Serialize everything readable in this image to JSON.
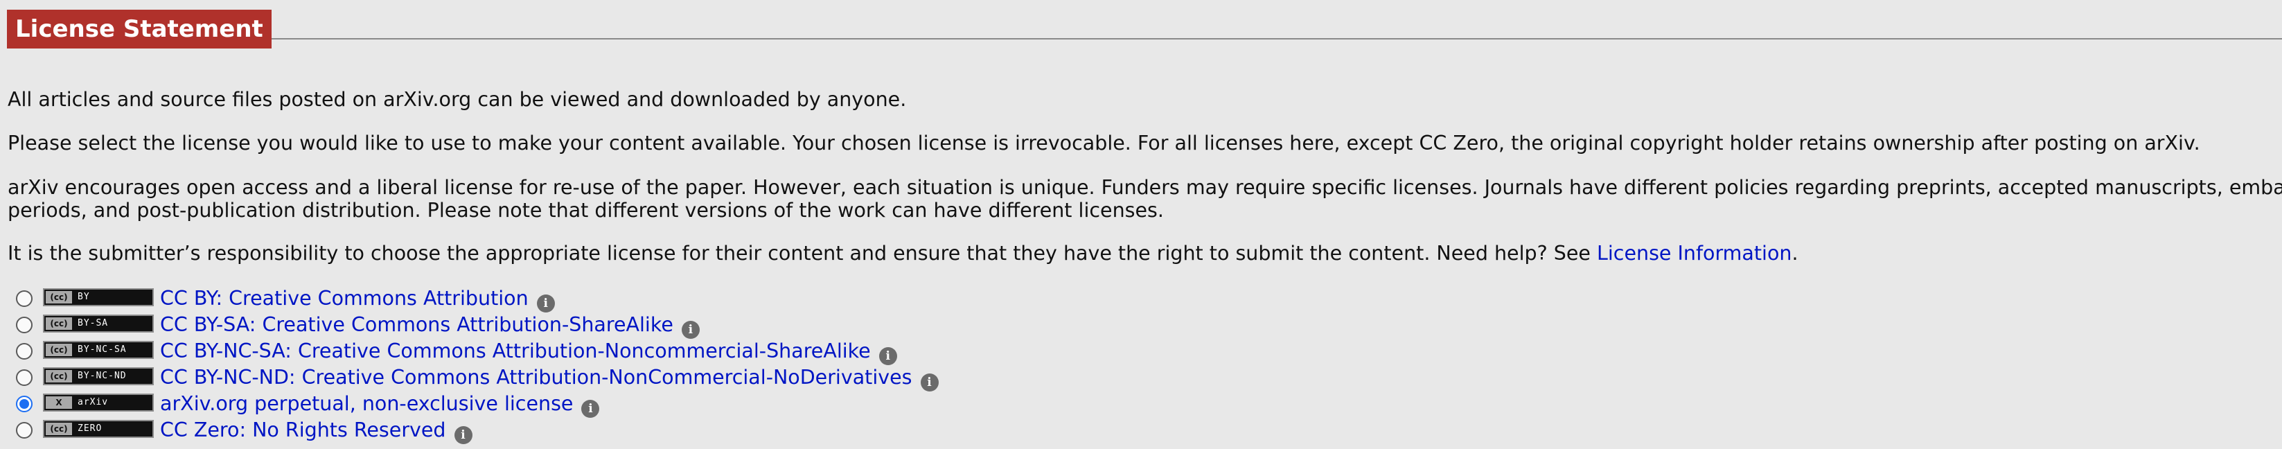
{
  "section": {
    "title": "License Statement"
  },
  "paragraphs": {
    "p1": "All articles and source files posted on arXiv.org can be viewed and downloaded by anyone.",
    "p2": "Please select the license you would like to use to make your content available. Your chosen license is irrevocable. For all licenses here, except CC Zero, the original copyright holder retains ownership after posting on arXiv.",
    "p3_line1": "arXiv encourages open access and a liberal license for re-use of the paper. However, each situation is unique. Funders may require specific licenses. Journals have different policies regarding preprints, accepted manuscripts, embargo",
    "p3_line2": "periods, and post-publication distribution. Please note that different versions of the work can have different licenses.",
    "p4_text": "It is the submitter’s responsibility to choose the appropriate license for their content and ensure that they have the right to submit the content. Need help? See ",
    "p4_link": "License Information",
    "p4_end": "."
  },
  "licenses": [
    {
      "badge_left": "(cc)",
      "badge_text": "BY",
      "label": "CC BY: Creative Commons Attribution",
      "selected": false
    },
    {
      "badge_left": "(cc)",
      "badge_text": "BY-SA",
      "label": "CC BY-SA: Creative Commons Attribution-ShareAlike",
      "selected": false
    },
    {
      "badge_left": "(cc)",
      "badge_text": "BY-NC-SA",
      "label": "CC BY-NC-SA: Creative Commons Attribution-Noncommercial-ShareAlike",
      "selected": false
    },
    {
      "badge_left": "(cc)",
      "badge_text": "BY-NC-ND",
      "label": "CC BY-NC-ND: Creative Commons Attribution-NonCommercial-NoDerivatives",
      "selected": false
    },
    {
      "badge_left": "X",
      "badge_text": "arXiv",
      "label": "arXiv.org perpetual, non-exclusive license",
      "selected": true
    },
    {
      "badge_left": "(cc)",
      "badge_text": "ZERO",
      "label": "CC Zero: No Rights Reserved",
      "selected": false
    }
  ],
  "info_icon_glyph": "i",
  "colors": {
    "header_bg": "#b0312b",
    "link": "#0015c4",
    "radio_selected": "#1e6ff2",
    "page_bg": "#e8e8e8"
  }
}
